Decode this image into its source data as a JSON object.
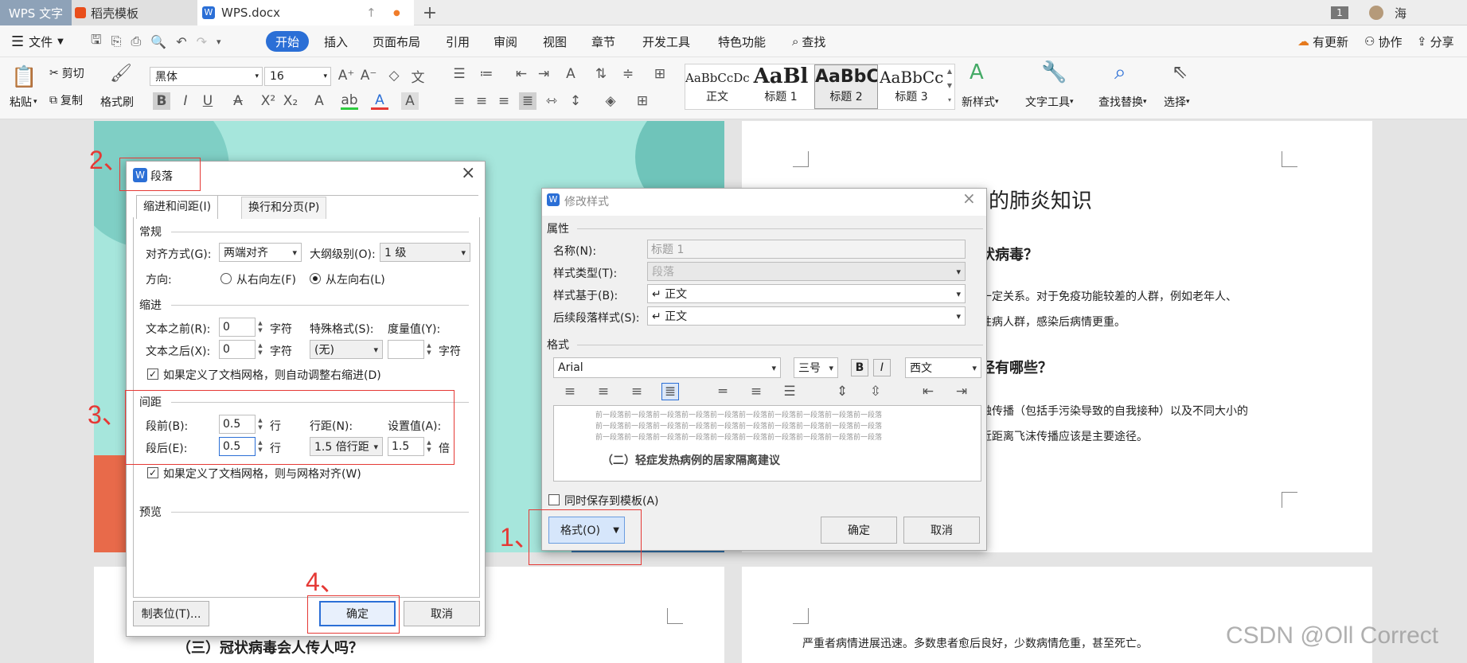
{
  "titlebar": {
    "app_tab": "WPS 文字",
    "tab1": "稻壳模板",
    "tab2": "WPS.docx",
    "page_badge": "1",
    "user": "海"
  },
  "menubar": {
    "file": "文件",
    "start": "开始",
    "insert": "插入",
    "layout": "页面布局",
    "reference": "引用",
    "review": "审阅",
    "view": "视图",
    "chapter": "章节",
    "dev": "开发工具",
    "special": "特色功能",
    "search": "查找",
    "update": "有更新",
    "collab": "协作",
    "share": "分享"
  },
  "ribbon": {
    "paste": "粘贴",
    "cut": "剪切",
    "copy": "复制",
    "format_painter": "格式刷",
    "font": "黑体",
    "size": "16",
    "styles": [
      {
        "preview": "AaBbCcDc",
        "name": "正文"
      },
      {
        "preview": "AaBl",
        "name": "标题 1"
      },
      {
        "preview": "AaBbC",
        "name": "标题 2"
      },
      {
        "preview": "AaBbCc",
        "name": "标题 3"
      }
    ],
    "new_style": "新样式",
    "text_tool": "文字工具",
    "find_replace": "查找替换",
    "select": "选择"
  },
  "doc": {
    "right_title": "的肺炎知识",
    "h1": "状病毒？",
    "p1": "一定关系。对于免疫功能较差的人群，例如老年人、",
    "p2": "性病人群，感染后病情更重。",
    "h2": "径有哪些？",
    "p3": "触传播（包括手污染导致的自我接种）以及不同大小的",
    "p4": "近距离飞沫传播应该是主要途径。",
    "bottom_left": "（三）冠状病毒会人传人吗？",
    "bottom_right": "严重者病情进展迅速。多数患者愈后良好，少数病情危重，甚至死亡。"
  },
  "para_dialog": {
    "title": "段落",
    "tab_indent": "缩进和间距(I)",
    "tab_break": "换行和分页(P)",
    "section_general": "常规",
    "align_label": "对齐方式(G):",
    "align_value": "两端对齐",
    "outline_label": "大纲级别(O):",
    "outline_value": "1 级",
    "direction_label": "方向:",
    "dir_rtl": "从右向左(F)",
    "dir_ltr": "从左向右(L)",
    "section_indent": "缩进",
    "before_text_label": "文本之前(R):",
    "before_text_value": "0",
    "after_text_label": "文本之后(X):",
    "after_text_value": "0",
    "unit_char": "字符",
    "special_label": "特殊格式(S):",
    "special_value": "(无)",
    "measure_label": "度量值(Y):",
    "measure_value": "",
    "grid_indent": "如果定义了文档网格，则自动调整右缩进(D)",
    "section_spacing": "间距",
    "before_label": "段前(B):",
    "before_value": "0.5",
    "after_label": "段后(E):",
    "after_value": "0.5",
    "unit_line": "行",
    "line_spacing_label": "行距(N):",
    "line_spacing_value": "1.5 倍行距",
    "set_label": "设置值(A):",
    "set_value": "1.5",
    "unit_times": "倍",
    "grid_align": "如果定义了文档网格，则与网格对齐(W)",
    "section_preview": "预览",
    "tabs_button": "制表位(T)...",
    "ok": "确定",
    "cancel": "取消"
  },
  "style_dialog": {
    "title": "修改样式",
    "section_props": "属性",
    "name_label": "名称(N):",
    "name_value": "标题 1",
    "type_label": "样式类型(T):",
    "type_value": "段落",
    "based_label": "样式基于(B):",
    "based_value": "↵ 正文",
    "next_label": "后续段落样式(S):",
    "next_value": "↵ 正文",
    "section_format": "格式",
    "font_value": "Arial",
    "size_value": "三号",
    "script_value": "西文",
    "preview_line": "前一段落前一段落前一段落前一段落前一段落前一段落前一段落前一段落前一段落前一段落",
    "preview_sample": "（二）轻症发热病例的居家隔离建议",
    "save_template": "同时保存到模板(A)",
    "format_button": "格式(O)",
    "ok": "确定",
    "cancel": "取消"
  },
  "annotations": {
    "a1": "1、",
    "a2": "2、",
    "a3": "3、",
    "a4": "4、"
  },
  "watermark": "CSDN @Oll Correct",
  "colors": {
    "accent": "#2b6fd6",
    "annotation": "#e53935",
    "teal_bg": "#a6e6dc"
  }
}
